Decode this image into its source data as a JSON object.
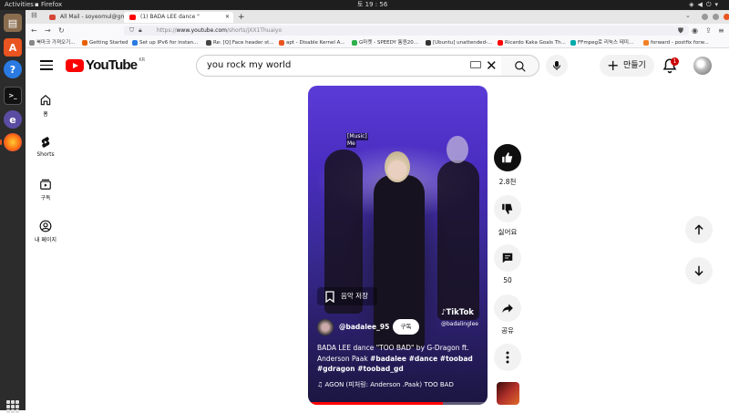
{
  "system": {
    "activities": "Activities",
    "app_name": "Firefox",
    "clock": "토 19 : 56"
  },
  "tabs": [
    {
      "label": "All Mail - soyeomul@gm",
      "fav_color": "#d44638"
    },
    {
      "label": "(1) BADA LEE dance \"",
      "fav_color": "#ff0000"
    }
  ],
  "url": {
    "prefix": "https://",
    "host": "www.youtube.com",
    "path": "/shorts/jXX1Thuaiyo"
  },
  "bookmarks": [
    {
      "label": "북마크 가져오기...",
      "color": "#888"
    },
    {
      "label": "Getting Started",
      "color": "#e66000"
    },
    {
      "label": "Set up IPv6 for instan...",
      "color": "#2a7ae2"
    },
    {
      "label": "Re: [Q] Face header st...",
      "color": "#444"
    },
    {
      "label": "apt - Disable Kernel A...",
      "color": "#e95420"
    },
    {
      "label": "G마켓 - SPEEDY 통원20...",
      "color": "#2eb04a"
    },
    {
      "label": "[Ubuntu] unattended-...",
      "color": "#333"
    },
    {
      "label": "Ricardo Kaka Goals Th...",
      "color": "#ff0000"
    },
    {
      "label": "FFmpeg로 리눅스 테미...",
      "color": "#0aa"
    },
    {
      "label": "forward - postfix forw...",
      "color": "#f48024"
    }
  ],
  "youtube": {
    "logo_text": "YouTube",
    "country_code": "KR",
    "search_value": "you rock my world",
    "create_label": "만들기",
    "notification_count": "1",
    "nav": [
      {
        "label": "홈",
        "icon": "home-icon"
      },
      {
        "label": "Shorts",
        "icon": "shorts-icon"
      },
      {
        "label": "구독",
        "icon": "subscriptions-icon"
      },
      {
        "label": "내 페이지",
        "icon": "you-icon"
      }
    ]
  },
  "video": {
    "caption_line1": "[Music]",
    "caption_line2": "Me",
    "save_music": "음악 저장",
    "tiktok_logo": "TikTok",
    "tiktok_handle": "@badalinglee",
    "channel": "@badalee_95",
    "subscribe": "구독",
    "title_plain": "BADA LEE dance \"TOO BAD\" by G-Dragon ft. Anderson Paak ",
    "title_tags": "#badalee #dance #toobad #gdragon #toobad_gd",
    "music": "♫ AGON (피처링: Anderson .Paak)    TOO BAD",
    "progress": 0.75
  },
  "actions": {
    "likes": "2.8천",
    "dislike": "싫어요",
    "comments": "50",
    "share": "공유"
  }
}
